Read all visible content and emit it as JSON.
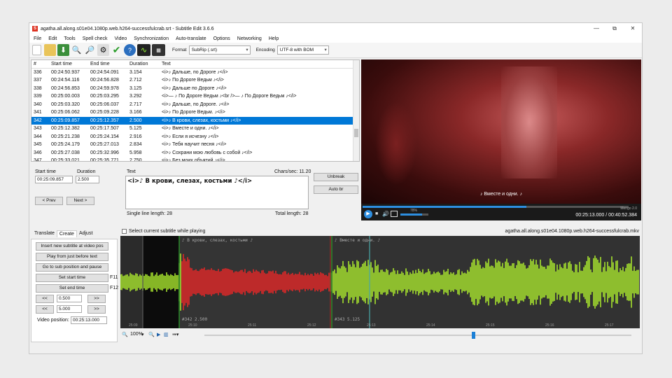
{
  "window": {
    "title": "agatha.all.along.s01e04.1080p.web.h264-successfulcrab.srt - Subtitle Edit 3.6.6",
    "min": "—",
    "max": "⧉",
    "close": "✕"
  },
  "menu": [
    "File",
    "Edit",
    "Tools",
    "Spell check",
    "Video",
    "Synchronization",
    "Auto-translate",
    "Options",
    "Networking",
    "Help"
  ],
  "toolbar": {
    "format_label": "Format",
    "format_value": "SubRip (.srt)",
    "encoding_label": "Encoding",
    "encoding_value": "UTF-8 with BOM"
  },
  "grid": {
    "headers": [
      "#",
      "Start time",
      "End time",
      "Duration",
      "Text"
    ],
    "rows": [
      [
        "336",
        "00:24:50.937",
        "00:24:54.091",
        "3.154",
        "<i>♪ Дальше, по Дороге ♪</i>"
      ],
      [
        "337",
        "00:24:54.116",
        "00:24:56.828",
        "2.712",
        "<i>♪ По Дороге Ведьм ♪</i>"
      ],
      [
        "338",
        "00:24:56.853",
        "00:24:59.978",
        "3.125",
        "<i>♪ Дальше по Дороге ♪</i>"
      ],
      [
        "339",
        "00:25:00.003",
        "00:25:03.295",
        "3.292",
        "<i>— ♪ По Дороге Ведьм ♪<br />— ♪ По Дороге Ведьм ♪</i>"
      ],
      [
        "340",
        "00:25:03.320",
        "00:25:06.037",
        "2.717",
        "<i>♪ Дальше, по Дороге. ♪</i>"
      ],
      [
        "341",
        "00:25:06.062",
        "00:25:09.228",
        "3.166",
        "<i>♪ По Дороге Ведьм. ♪</i>"
      ],
      [
        "342",
        "00:25:09.857",
        "00:25:12.357",
        "2.500",
        "<i>♪ В крови, слезах, костьми ♪</i>"
      ],
      [
        "343",
        "00:25:12.382",
        "00:25:17.507",
        "5.125",
        "<i>♪ Вместе и одни. ♪</i>"
      ],
      [
        "344",
        "00:25:21.238",
        "00:25:24.154",
        "2.916",
        "<i>♪ Если я исчезну ♪</i>"
      ],
      [
        "345",
        "00:25:24.179",
        "00:25:27.013",
        "2.834",
        "<i>♪ Тебя научит песня ♪</i>"
      ],
      [
        "346",
        "00:25:27.038",
        "00:25:32.996",
        "5.958",
        "<i>♪ Сохрани мою любовь с собой ♪</i>"
      ],
      [
        "347",
        "00:25:33.021",
        "00:25:35.771",
        "2.750",
        "<i>♪ Без моих объятий ♪</i>"
      ]
    ],
    "active_index": 6
  },
  "edit": {
    "start_label": "Start time",
    "start_value": "00:25:09.857",
    "duration_label": "Duration",
    "duration_value": "2.500",
    "text_label": "Text",
    "chars_sec": "Chars/sec: 11.20",
    "text_value": "<i>♪ В крови, слезах, костьми ♪</i>",
    "single_line": "Single line length: 28",
    "total_length": "Total length: 28",
    "prev": "< Prev",
    "next": "Next >",
    "unbreak": "Unbreak",
    "autobr": "Auto br"
  },
  "video": {
    "subtitle": "♪ Вместе и одни. ♪",
    "time": "00:25:13.000 / 00:40:52.384",
    "volume": "78%",
    "mode": "Mengo 2.0"
  },
  "create": {
    "tabs": [
      "Translate",
      "Create",
      "Adjust"
    ],
    "checkbox_label": "Select current subtitle while playing",
    "filename": "agatha.all.along.s01e04.1080p.web.h264-successfulcrab.mkv",
    "buttons": [
      "Insert new subtitle at video pos",
      "Play from just before text",
      "Go to sub position and pause",
      "Set start time",
      "Set end time"
    ],
    "f11": "F11",
    "f12": "F12",
    "step1": "0.500",
    "step2": "5.000",
    "back": "<<",
    "fwd": ">>",
    "videopos_label": "Video position:",
    "videopos_value": "00:25:13.000"
  },
  "wave": {
    "sub1": "♪ В крови, слезах, костьми ♪",
    "sub2": "♪ Вместе и одни. ♪",
    "info1": "#342 2.500",
    "info2": "#343 5.125",
    "ticks": [
      "25:09",
      "25:10",
      "25:11",
      "25:12",
      "25:13",
      "25:14",
      "25:15",
      "25:16",
      "25:17"
    ],
    "zoom": "100%"
  },
  "colors": {
    "accent": "#0078d7",
    "wave_green": "#a6e22e",
    "wave_red": "#e02828"
  }
}
